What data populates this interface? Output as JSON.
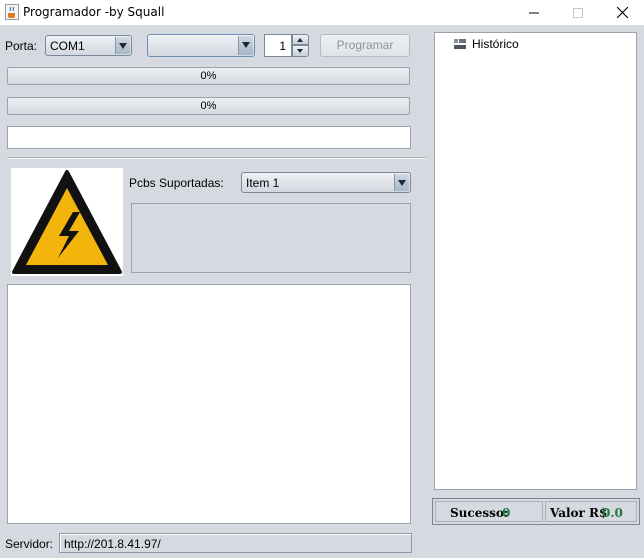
{
  "window": {
    "title": "Programador -by Squall",
    "icons": {
      "app": "java-cup-icon",
      "minimize": "minimize-icon",
      "maximize": "maximize-icon",
      "close": "close-icon"
    }
  },
  "toolbar": {
    "port_label": "Porta:",
    "port_value": "COM1",
    "device_value": "",
    "count_value": "1",
    "program_button": "Programar"
  },
  "progress": [
    {
      "text": "0%",
      "value": 0
    },
    {
      "text": "0%",
      "value": 0
    }
  ],
  "pcbs": {
    "label": "Pcbs Suportadas:",
    "selected": "Item 1"
  },
  "tree": {
    "root_label": "Histórico",
    "root_icon": "tree-node-icon"
  },
  "status": {
    "success_label": "Sucesso:",
    "success_value": "0",
    "value_label": "Valor R$",
    "value_value": "0.0"
  },
  "server": {
    "label": "Servidor:",
    "url": "http://201.8.41.97/"
  },
  "colors": {
    "background": "#d6d9df",
    "status_number": "#1e7a3c",
    "warning_yellow": "#f3b40b"
  }
}
